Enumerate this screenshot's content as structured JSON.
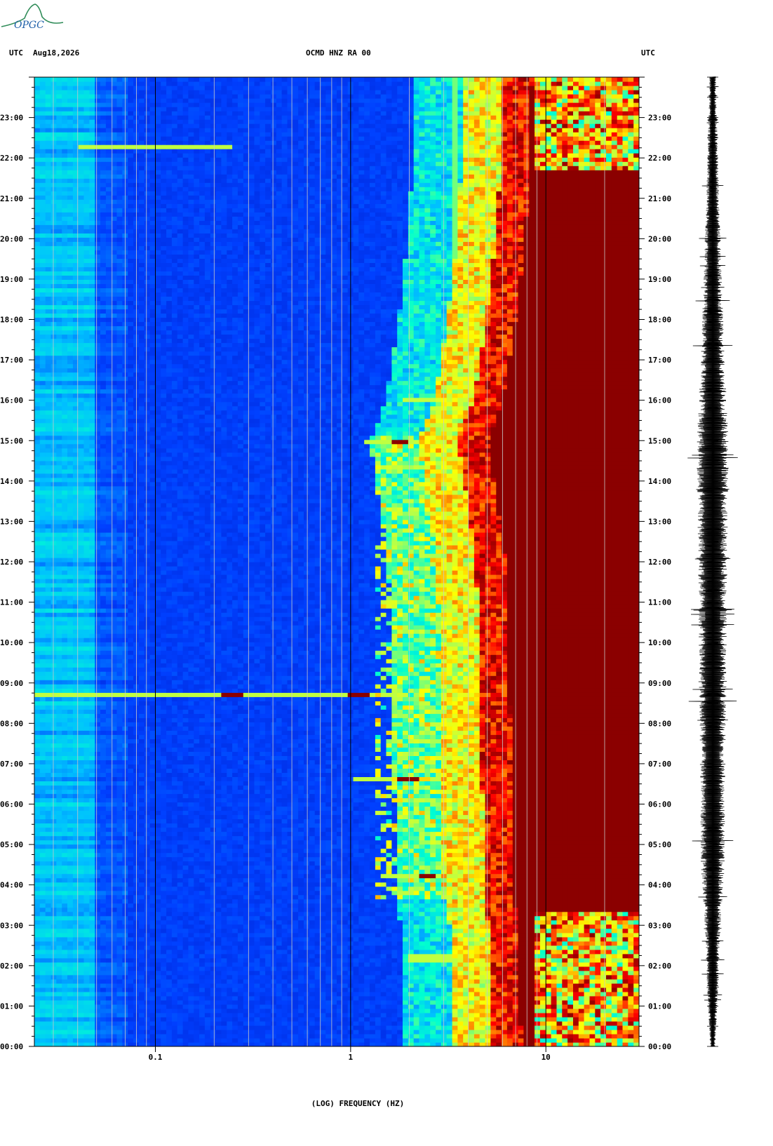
{
  "header": {
    "left_tz": "UTC",
    "date": "Aug18,2026",
    "station": "OCMD HNZ RA 00",
    "right_tz": "UTC"
  },
  "logo": {
    "text": "OPGC",
    "colors": [
      "#2e8b57",
      "#1e5fa8"
    ]
  },
  "chart_data": {
    "type": "heatmap",
    "title": "OCMD HNZ RA 00",
    "xlabel": "(LOG) FREQUENCY (HZ)",
    "x_scale": "log",
    "xlim": [
      0.024,
      30
    ],
    "x_ticks": [
      {
        "value": 0.1,
        "label": "0.1"
      },
      {
        "value": 1,
        "label": "1"
      },
      {
        "value": 10,
        "label": "10"
      }
    ],
    "y_ticks_hours": [
      "00:00",
      "01:00",
      "02:00",
      "03:00",
      "04:00",
      "05:00",
      "06:00",
      "07:00",
      "08:00",
      "09:00",
      "10:00",
      "11:00",
      "12:00",
      "13:00",
      "14:00",
      "15:00",
      "16:00",
      "17:00",
      "18:00",
      "19:00",
      "20:00",
      "21:00",
      "22:00",
      "23:00"
    ],
    "ylim_hours": [
      0,
      24
    ],
    "colormap": [
      "#0000a0",
      "#0040ff",
      "#00c0ff",
      "#00ffd0",
      "#c0ff40",
      "#ffff00",
      "#ff8000",
      "#ff0000",
      "#8b0000"
    ],
    "saturation_edge_hz_by_hour": [
      [
        0,
        7.5
      ],
      [
        2,
        7.3
      ],
      [
        3,
        7.2
      ],
      [
        4,
        6.7
      ],
      [
        6,
        6.7
      ],
      [
        9,
        6.5
      ],
      [
        12,
        6.2
      ],
      [
        15,
        5.0
      ],
      [
        16,
        6.0
      ],
      [
        18,
        7.0
      ],
      [
        20,
        7.8
      ],
      [
        21.5,
        8.2
      ],
      [
        24,
        8.5
      ]
    ],
    "events": [
      {
        "hour": 8.72,
        "f_min": 0.02,
        "f_max": 1.8,
        "peak_hz": [
          0.25,
          1.1
        ]
      },
      {
        "hour": 4.2,
        "f_min": 1.4,
        "f_max": 8,
        "peak_hz": [
          2.5
        ]
      },
      {
        "hour": 6.6,
        "f_min": 1.0,
        "f_max": 7,
        "peak_hz": [
          2.0
        ]
      },
      {
        "hour": 15.0,
        "f_min": 1.2,
        "f_max": 6,
        "peak_hz": [
          1.8
        ]
      },
      {
        "hour": 2.2,
        "f_min": 2.0,
        "f_max": 8,
        "peak_hz": []
      },
      {
        "hour": 16.05,
        "f_min": 1.8,
        "f_max": 4,
        "peak_hz": []
      },
      {
        "hour": 22.3,
        "f_min": 0.04,
        "f_max": 0.25,
        "peak_hz": []
      }
    ],
    "spectral_line_hz": 3.5,
    "trace": {
      "label": "seismogram",
      "amplitude_by_hour": [
        [
          0,
          0.1
        ],
        [
          2,
          0.25
        ],
        [
          3,
          0.3
        ],
        [
          4.5,
          0.45
        ],
        [
          8,
          0.5
        ],
        [
          12,
          0.55
        ],
        [
          15,
          0.6
        ],
        [
          17,
          0.45
        ],
        [
          20,
          0.3
        ],
        [
          22,
          0.2
        ],
        [
          24,
          0.12
        ]
      ]
    }
  }
}
